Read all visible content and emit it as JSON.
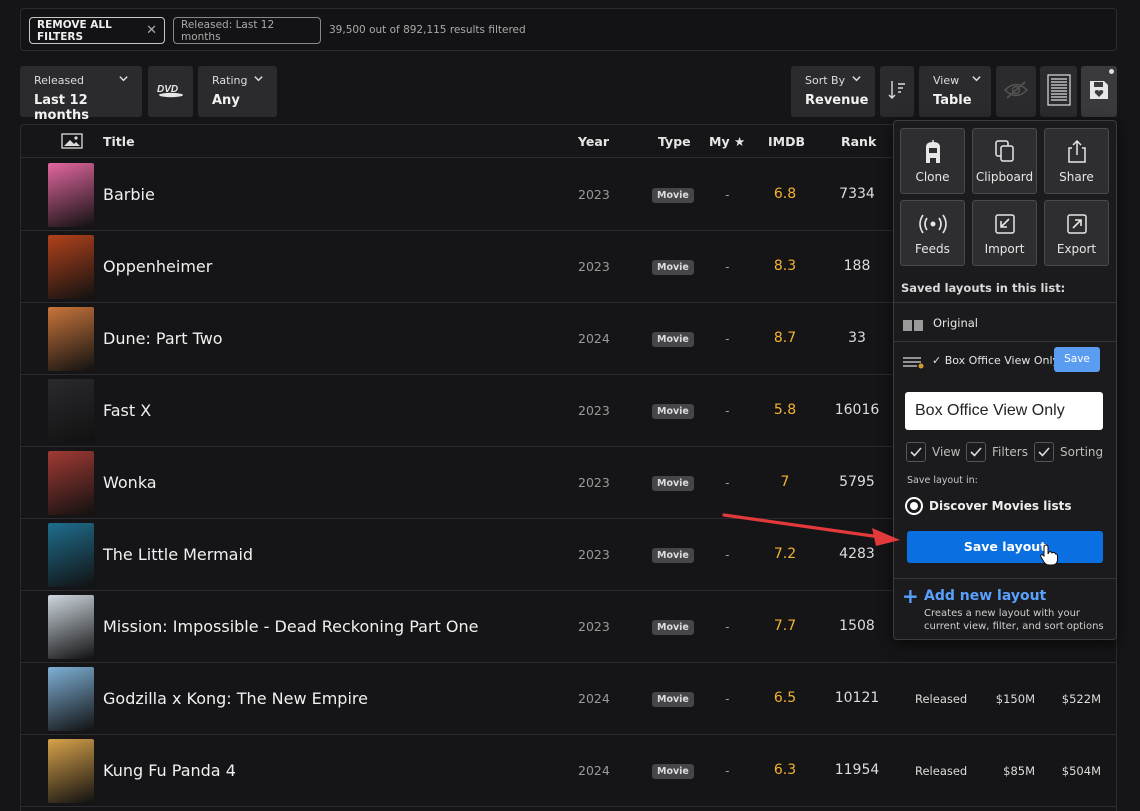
{
  "filters": {
    "remove_all": "REMOVE ALL FILTERS",
    "active_chip": "Released: Last 12 months",
    "result_count": "39,500 out of 892,115 results filtered"
  },
  "controls": {
    "released": {
      "label": "Released",
      "value": "Last 12 months"
    },
    "dvd_icon": "dvd-icon",
    "rating": {
      "label": "Rating",
      "value": "Any"
    },
    "sort_by": {
      "label": "Sort By",
      "value": "Revenue"
    },
    "view": {
      "label": "View",
      "value": "Table"
    }
  },
  "columns": {
    "title": "Title",
    "year": "Year",
    "type": "Type",
    "my": "My",
    "imdb": "IMDB",
    "rank": "Rank"
  },
  "rows": [
    {
      "title": "Barbie",
      "year": "2023",
      "type": "Movie",
      "my": "-",
      "imdb": "6.8",
      "rank": "7334",
      "status": "",
      "budget": "",
      "gross": "",
      "poster_color": "#e3679f"
    },
    {
      "title": "Oppenheimer",
      "year": "2023",
      "type": "Movie",
      "my": "-",
      "imdb": "8.3",
      "rank": "188",
      "status": "",
      "budget": "",
      "gross": "",
      "poster_color": "#b2421c"
    },
    {
      "title": "Dune: Part Two",
      "year": "2024",
      "type": "Movie",
      "my": "-",
      "imdb": "8.7",
      "rank": "33",
      "status": "",
      "budget": "",
      "gross": "",
      "poster_color": "#c9753b"
    },
    {
      "title": "Fast X",
      "year": "2023",
      "type": "Movie",
      "my": "-",
      "imdb": "5.8",
      "rank": "16016",
      "status": "",
      "budget": "",
      "gross": "",
      "poster_color": "#2a2a2e"
    },
    {
      "title": "Wonka",
      "year": "2023",
      "type": "Movie",
      "my": "-",
      "imdb": "7",
      "rank": "5795",
      "status": "",
      "budget": "",
      "gross": "",
      "poster_color": "#a23a34"
    },
    {
      "title": "The Little Mermaid",
      "year": "2023",
      "type": "Movie",
      "my": "-",
      "imdb": "7.2",
      "rank": "4283",
      "status": "",
      "budget": "",
      "gross": "",
      "poster_color": "#1f6e8e"
    },
    {
      "title": "Mission: Impossible - Dead Reckoning Part One",
      "year": "2023",
      "type": "Movie",
      "my": "-",
      "imdb": "7.7",
      "rank": "1508",
      "status": "",
      "budget": "",
      "gross": "",
      "poster_color": "#cfd8e0"
    },
    {
      "title": "Godzilla x Kong: The New Empire",
      "year": "2024",
      "type": "Movie",
      "my": "-",
      "imdb": "6.5",
      "rank": "10121",
      "status": "Released",
      "budget": "$150M",
      "gross": "$522M",
      "poster_color": "#7fb0d6"
    },
    {
      "title": "Kung Fu Panda 4",
      "year": "2024",
      "type": "Movie",
      "my": "-",
      "imdb": "6.3",
      "rank": "11954",
      "status": "Released",
      "budget": "$85M",
      "gross": "$504M",
      "poster_color": "#d8a24a"
    }
  ],
  "panel": {
    "actions": [
      {
        "label": "Clone",
        "icon": "clone-icon"
      },
      {
        "label": "Clipboard",
        "icon": "clipboard-icon"
      },
      {
        "label": "Share",
        "icon": "share-icon"
      },
      {
        "label": "Feeds",
        "icon": "feeds-icon"
      },
      {
        "label": "Import",
        "icon": "import-icon"
      },
      {
        "label": "Export",
        "icon": "export-icon"
      }
    ],
    "saved_heading": "Saved layouts in this list:",
    "layout_original": "Original",
    "layout_current": "✓ Box Office View Only",
    "save_small": "Save",
    "name_value": "Box Office View Only",
    "options": {
      "view": "View",
      "filters": "Filters",
      "sorting": "Sorting"
    },
    "save_in_label": "Save layout in:",
    "save_in_option": "Discover Movies lists",
    "save_layout": "Save layout",
    "add_new_title": "Add new layout",
    "add_new_desc": "Creates a new layout with your current view, filter, and sort options"
  },
  "colors": {
    "accent": "#0a6fe0",
    "imdb": "#f5b233",
    "link": "#5aa0ff"
  }
}
